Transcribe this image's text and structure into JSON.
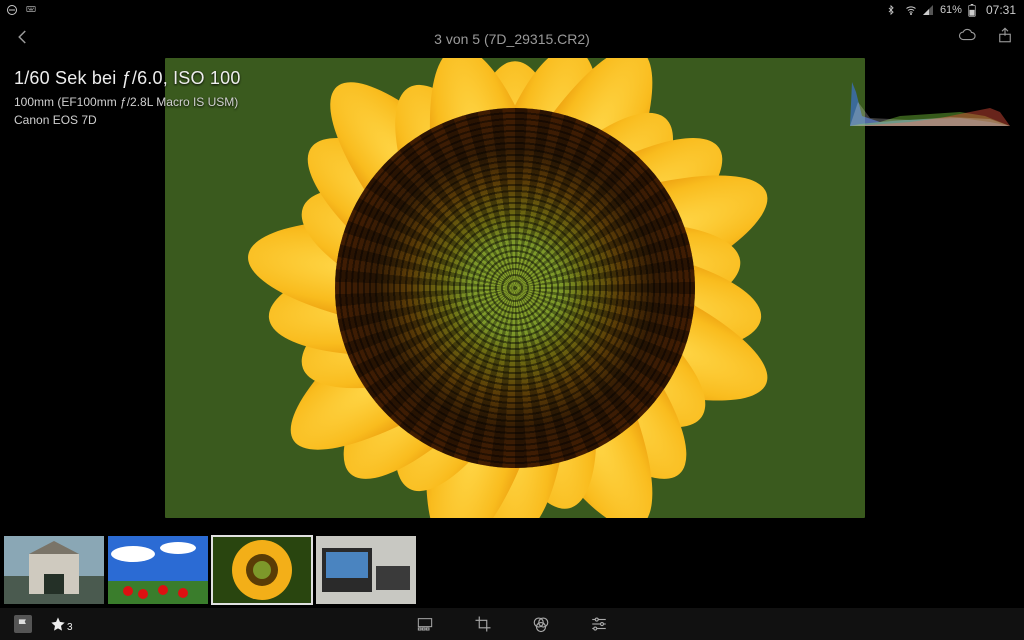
{
  "status": {
    "battery_pct": "61%",
    "clock": "07:31"
  },
  "header": {
    "title": "3 von 5 (7D_29315.CR2)"
  },
  "meta": {
    "exposure": "1/60 Sek bei ƒ/6.0, ISO 100",
    "lens": "100mm (EF100mm ƒ/2.8L Macro IS USM)",
    "camera": "Canon EOS 7D"
  },
  "rating": {
    "stars": "3"
  },
  "filmstrip": {
    "selected_index": 2,
    "count": 4
  }
}
